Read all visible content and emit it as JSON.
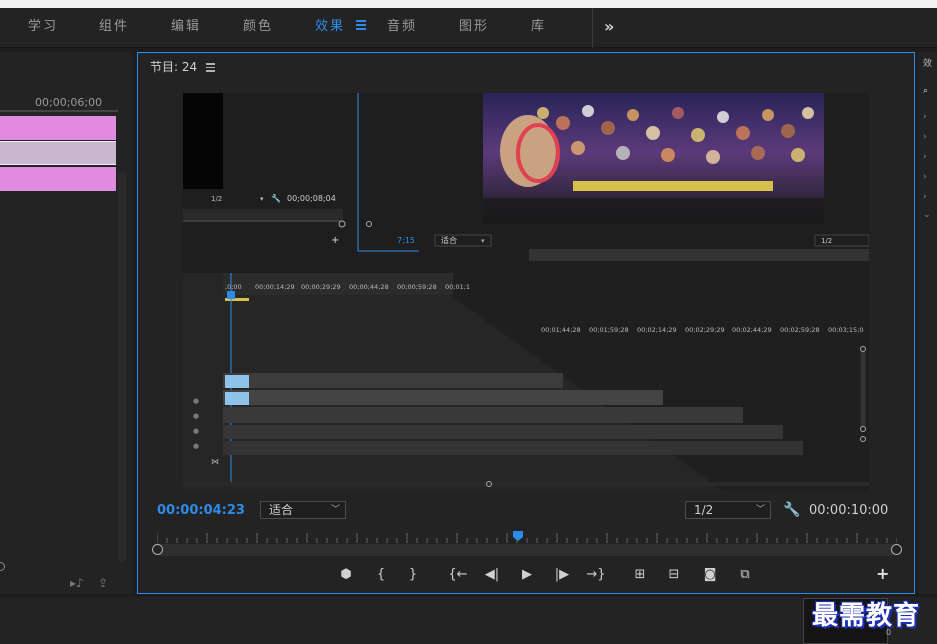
{
  "workspace_tabs": [
    {
      "label": "学习"
    },
    {
      "label": "组件"
    },
    {
      "label": "编辑"
    },
    {
      "label": "颜色"
    },
    {
      "label": "效果",
      "active": true
    },
    {
      "label": "音频"
    },
    {
      "label": "图形"
    },
    {
      "label": "库"
    }
  ],
  "more_tabs_glyph": "»",
  "left_panel": {
    "timecode": "00;00;06;00"
  },
  "program": {
    "title": "节目: 24",
    "timecode_current": "00:00:04:23",
    "zoom_select": "适合",
    "resolution_select": "1/2",
    "timecode_duration": "00:00:10:00",
    "transport_icons": [
      "add-marker-icon",
      "mark-in-icon",
      "mark-out-icon",
      "go-to-in-icon",
      "step-back-icon",
      "play-icon",
      "step-forward-icon",
      "go-to-out-icon",
      "lift-icon",
      "extract-icon",
      "export-frame-icon",
      "compare-view-icon"
    ],
    "transport_glyphs": [
      "⬢",
      "{",
      "}",
      "{←",
      "◀|",
      "▶",
      "|▶",
      "→}",
      "⊞",
      "⊟",
      "◙",
      "⧉"
    ],
    "add_button": "+"
  },
  "preview": {
    "source_res": "1/2",
    "source_tc": "00;00;08;04",
    "inner_tc": "7;15",
    "inner_zoom": "适合",
    "inner_res": "1/2",
    "timeline_ruler_top": [
      ",0;00",
      "00;00;14;29",
      "00;00;29;29",
      "00;00;44;28",
      "00;00;59;28",
      "00;01;1"
    ],
    "timeline_ruler_mid": [
      "00;01;44;28",
      "00;01;59;28",
      "00;02;14;29",
      "00;02;29;29",
      "00;02;44;29",
      "00;02;59;28",
      "00;03;15;0"
    ]
  },
  "watermark": "最需教育",
  "bottom_value": "0",
  "colors": {
    "accent": "#2d8ceb",
    "clip_pink": "#e08ae0",
    "clip_lilac": "#c9b7d0"
  }
}
